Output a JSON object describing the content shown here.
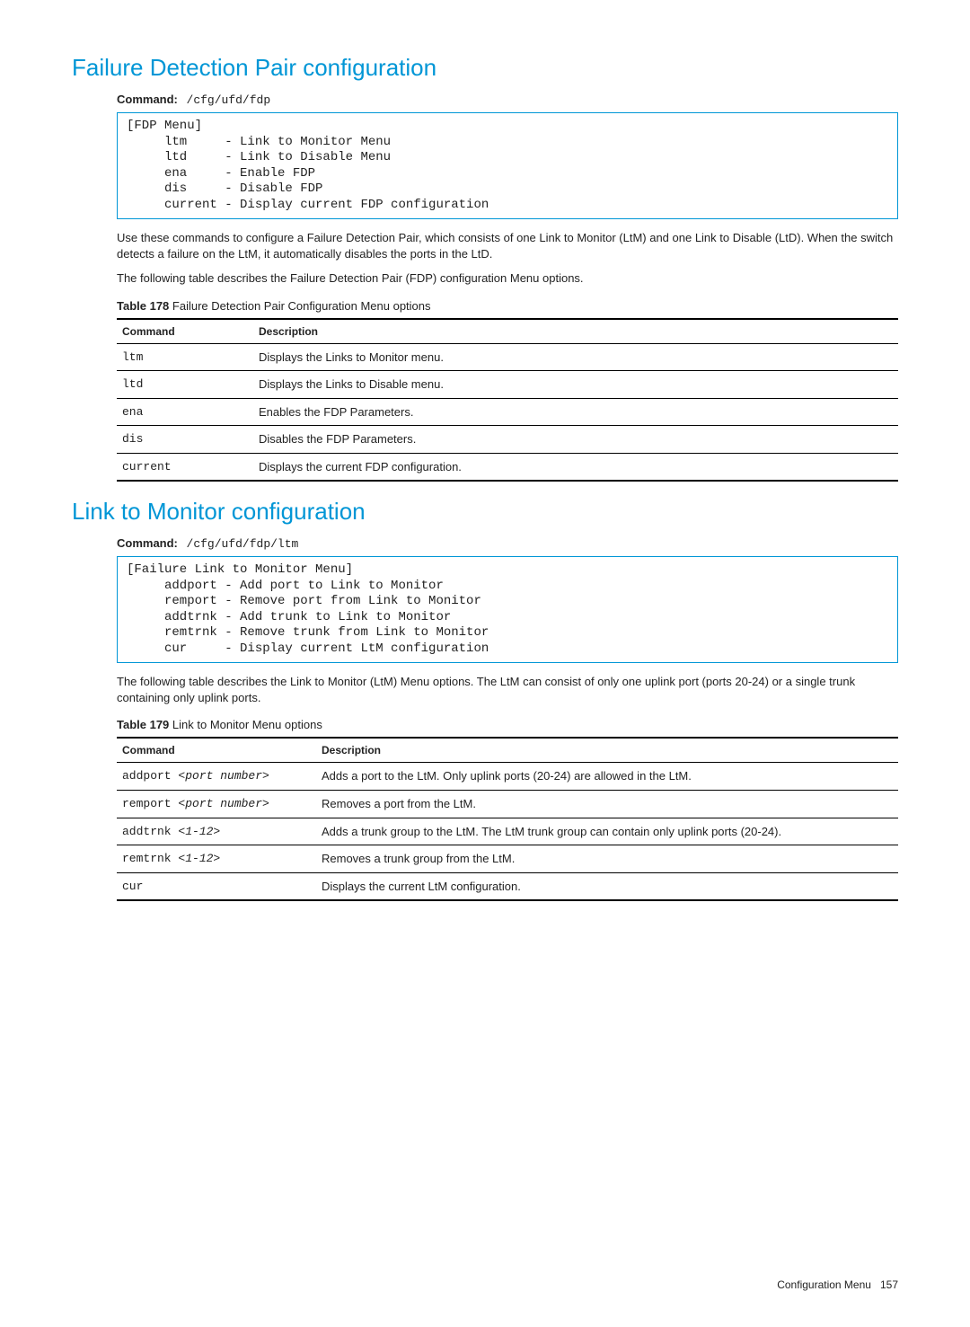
{
  "section1": {
    "heading": "Failure Detection Pair configuration",
    "command_label": "Command:",
    "command_path": "/cfg/ufd/fdp",
    "codeblock": "[FDP Menu]\n     ltm     - Link to Monitor Menu\n     ltd     - Link to Disable Menu\n     ena     - Enable FDP\n     dis     - Disable FDP\n     current - Display current FDP configuration",
    "para1": "Use these commands to configure a Failure Detection Pair, which consists of one Link to Monitor (LtM) and one Link to Disable (LtD). When the switch detects a failure on the LtM, it automatically disables the ports in the LtD.",
    "para2": "The following table describes the Failure Detection Pair (FDP) configuration Menu options.",
    "table_caption_label": "Table 178",
    "table_caption_text": " Failure Detection Pair Configuration Menu options",
    "th_cmd": "Command",
    "th_desc": "Description",
    "rows": [
      {
        "cmd": "ltm",
        "desc": "Displays the Links to Monitor menu."
      },
      {
        "cmd": "ltd",
        "desc": "Displays the Links to Disable menu."
      },
      {
        "cmd": "ena",
        "desc": "Enables the FDP Parameters."
      },
      {
        "cmd": "dis",
        "desc": "Disables the FDP Parameters."
      },
      {
        "cmd": "current",
        "desc": "Displays the current FDP configuration."
      }
    ]
  },
  "section2": {
    "heading": "Link to Monitor configuration",
    "command_label": "Command:",
    "command_path": "/cfg/ufd/fdp/ltm",
    "codeblock": "[Failure Link to Monitor Menu]\n     addport - Add port to Link to Monitor\n     remport - Remove port from Link to Monitor\n     addtrnk - Add trunk to Link to Monitor\n     remtrnk - Remove trunk from Link to Monitor\n     cur     - Display current LtM configuration",
    "para1": "The following table describes the Link to Monitor (LtM) Menu options. The LtM can consist of only one uplink port (ports 20-24) or a single trunk containing only uplink ports.",
    "table_caption_label": "Table 179",
    "table_caption_text": " Link to Monitor Menu options",
    "th_cmd": "Command",
    "th_desc": "Description",
    "rows": [
      {
        "cmd_pre": "addport ",
        "cmd_arg": "<port number>",
        "desc": "Adds a port to the LtM. Only uplink ports (20-24) are allowed in the LtM."
      },
      {
        "cmd_pre": "remport ",
        "cmd_arg": "<port number>",
        "desc": "Removes a port from the LtM."
      },
      {
        "cmd_pre": "addtrnk ",
        "cmd_arg": "<1-12>",
        "desc": "Adds a trunk group to the LtM. The LtM trunk group can contain only uplink ports (20-24)."
      },
      {
        "cmd_pre": "remtrnk ",
        "cmd_arg": "<1-12>",
        "desc": "Removes a trunk group from the LtM."
      },
      {
        "cmd_pre": "cur",
        "cmd_arg": "",
        "desc": "Displays the current LtM configuration."
      }
    ]
  },
  "footer": {
    "section": "Configuration Menu",
    "page": "157"
  }
}
